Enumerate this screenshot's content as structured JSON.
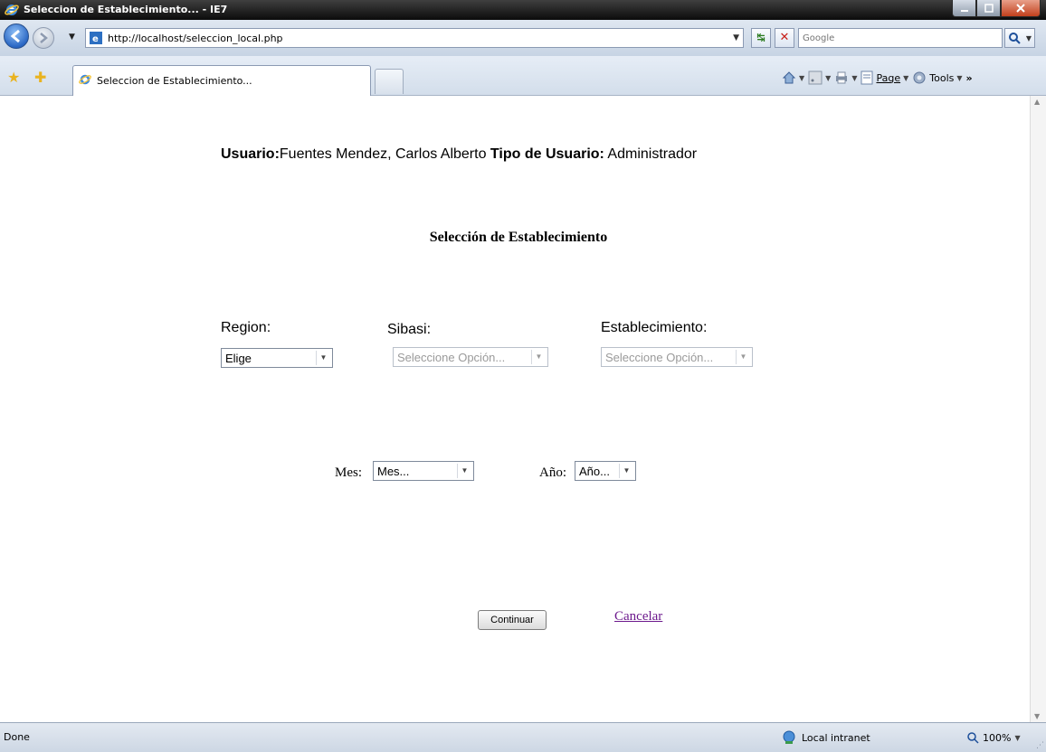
{
  "window": {
    "title": "Seleccion de Establecimiento... - IE7"
  },
  "address": {
    "url": "http://localhost/seleccion_local.php",
    "search_placeholder": "Google"
  },
  "tabs": {
    "active_label": "Seleccion de Establecimiento..."
  },
  "command_bar": {
    "page_label": "Page",
    "tools_label": "Tools"
  },
  "page": {
    "user_label": "Usuario:",
    "user_name": "Fuentes Mendez, Carlos Alberto",
    "user_type_label": "Tipo de Usuario:",
    "user_type": "Administrador",
    "heading": "Selección de Establecimiento",
    "region_label": "Region:",
    "region_value": "Elige",
    "sibasi_label": "Sibasi:",
    "sibasi_value": "Seleccione Opción...",
    "establecimiento_label": "Establecimiento:",
    "establecimiento_value": "Seleccione Opción...",
    "mes_label": "Mes:",
    "mes_value": "Mes...",
    "anio_label": "Año:",
    "anio_value": "Año...",
    "continuar_label": "Continuar",
    "cancelar_label": "Cancelar"
  },
  "status": {
    "text": "Done",
    "zone": "Local intranet",
    "zoom": "100%"
  },
  "colors": {
    "link_visited": "#6d1a8d",
    "titlebar": "#1a1a1a",
    "chrome": "#d3deeb"
  }
}
